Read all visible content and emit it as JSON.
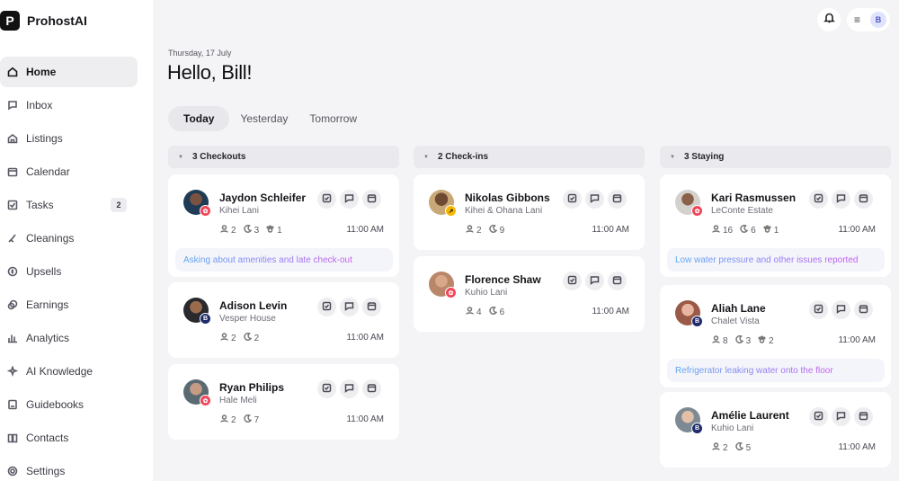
{
  "app": {
    "name": "ProhostAI",
    "logo_letter": "P"
  },
  "sidebar": {
    "items": [
      {
        "label": "Home",
        "icon": "home-icon",
        "active": true
      },
      {
        "label": "Inbox",
        "icon": "inbox-icon"
      },
      {
        "label": "Listings",
        "icon": "listings-icon"
      },
      {
        "label": "Calendar",
        "icon": "calendar-icon"
      },
      {
        "label": "Tasks",
        "icon": "tasks-icon",
        "badge": "2"
      },
      {
        "label": "Cleanings",
        "icon": "cleanings-icon"
      },
      {
        "label": "Upsells",
        "icon": "upsells-icon"
      },
      {
        "label": "Earnings",
        "icon": "earnings-icon"
      },
      {
        "label": "Analytics",
        "icon": "analytics-icon"
      },
      {
        "label": "AI Knowledge",
        "icon": "ai-knowledge-icon"
      },
      {
        "label": "Guidebooks",
        "icon": "guidebooks-icon"
      },
      {
        "label": "Contacts",
        "icon": "contacts-icon"
      },
      {
        "label": "Settings",
        "icon": "settings-icon"
      }
    ]
  },
  "header": {
    "user_initial": "B"
  },
  "main": {
    "date": "Thursday, 17 July",
    "greeting": "Hello, Bill!",
    "tabs": [
      {
        "label": "Today",
        "active": true
      },
      {
        "label": "Yesterday"
      },
      {
        "label": "Tomorrow"
      }
    ]
  },
  "columns": [
    {
      "title": "3 Checkouts",
      "cards": [
        {
          "name": "Jaydon Schleifer",
          "property": "Kihei Lani",
          "guests": "2",
          "nights": "3",
          "pets": "1",
          "time": "11:00 AM",
          "note": "Asking about amenities and late check-out",
          "badge_color": "#f0465a",
          "badge_glyph": "✿"
        },
        {
          "name": "Adison Levin",
          "property": "Vesper House",
          "guests": "2",
          "nights": "2",
          "time": "11:00 AM",
          "badge_color": "#1f2a6b",
          "badge_glyph": "B"
        },
        {
          "name": "Ryan Philips",
          "property": "Hale Meli",
          "guests": "2",
          "nights": "7",
          "time": "11:00 AM",
          "badge_color": "#f0465a",
          "badge_glyph": "✿"
        }
      ]
    },
    {
      "title": "2 Check-ins",
      "cards": [
        {
          "name": "Nikolas Gibbons",
          "property": "Kihei & Ohana Lani",
          "guests": "2",
          "nights": "9",
          "time": "11:00 AM",
          "badge_color": "#f5b800",
          "badge_glyph": "↗"
        },
        {
          "name": "Florence Shaw",
          "property": "Kuhio Lani",
          "guests": "4",
          "nights": "6",
          "time": "11:00 AM",
          "badge_color": "#f0465a",
          "badge_glyph": "✿"
        }
      ]
    },
    {
      "title": "3 Staying",
      "cards": [
        {
          "name": "Kari Rasmussen",
          "property": "LeConte Estate",
          "guests": "16",
          "nights": "6",
          "pets": "1",
          "time": "11:00 AM",
          "note": "Low water pressure and other issues reported",
          "badge_color": "#f0465a",
          "badge_glyph": "✿"
        },
        {
          "name": "Aliah Lane",
          "property": "Chalet Vista",
          "guests": "8",
          "nights": "3",
          "pets": "2",
          "time": "11:00 AM",
          "note": "Refrigerator leaking water onto the floor",
          "badge_color": "#1f2a6b",
          "badge_glyph": "B"
        },
        {
          "name": "Amélie Laurent",
          "property": "Kuhio Lani",
          "guests": "2",
          "nights": "5",
          "time": "11:00 AM",
          "badge_color": "#1f2a6b",
          "badge_glyph": "B"
        }
      ]
    }
  ]
}
